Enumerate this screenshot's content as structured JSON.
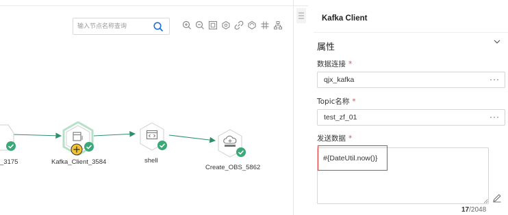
{
  "search": {
    "placeholder": "输入节点名称查询"
  },
  "toolbar": {
    "icons": [
      "zoom-in-icon",
      "zoom-out-icon",
      "fit-view-icon",
      "auto-layout-icon",
      "link-icon",
      "sync-icon",
      "grid-icon",
      "tree-layout-icon"
    ]
  },
  "nodes": [
    {
      "label": "_3175",
      "status": "success"
    },
    {
      "label": "Kafka_Client_3584",
      "status": "success",
      "selected": true
    },
    {
      "label": "shell",
      "status": "success"
    },
    {
      "label": "Create_OBS_5862",
      "status": "success"
    }
  ],
  "panel": {
    "title": "Kafka Client",
    "section": "属性",
    "fields": [
      {
        "label": "数据连接",
        "required": "*",
        "value": "qjx_kafka",
        "more": "···"
      },
      {
        "label": "Topic名称",
        "required": "*",
        "value": "test_zf_01",
        "more": "···"
      }
    ],
    "send": {
      "label": "发送数据",
      "required": "*",
      "value": "#{DateUtil.now()}",
      "count": "17",
      "max": "/2048"
    }
  },
  "colors": {
    "success": "#3aa877",
    "selected_ring": "#b6e0c8",
    "badge": "#f2c230",
    "highlight": "#e23b3b",
    "search_icon": "#1d6fe0",
    "edge": "#2f8f6a"
  }
}
